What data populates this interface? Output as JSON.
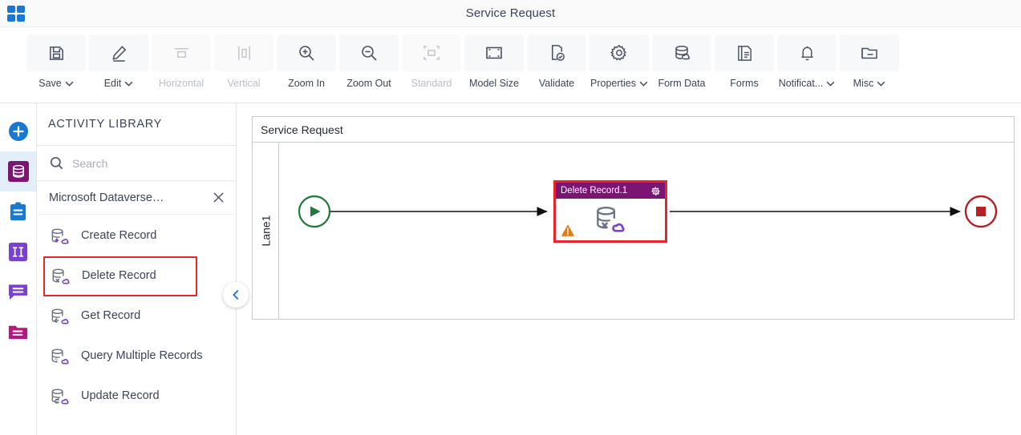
{
  "titlebar": {
    "app_icon": "app-grid-icon",
    "title": "Service Request"
  },
  "toolbar": {
    "items": [
      {
        "label": "Save",
        "icon": "save-icon",
        "has_caret": true,
        "disabled": false
      },
      {
        "label": "Edit",
        "icon": "edit-pencil-icon",
        "has_caret": true,
        "disabled": false
      },
      {
        "label": "Horizontal",
        "icon": "horizontal-align-icon",
        "has_caret": false,
        "disabled": true
      },
      {
        "label": "Vertical",
        "icon": "vertical-align-icon",
        "has_caret": false,
        "disabled": true
      },
      {
        "label": "Zoom In",
        "icon": "zoom-in-icon",
        "has_caret": false,
        "disabled": false
      },
      {
        "label": "Zoom Out",
        "icon": "zoom-out-icon",
        "has_caret": false,
        "disabled": false
      },
      {
        "label": "Standard",
        "icon": "standard-size-icon",
        "has_caret": false,
        "disabled": true
      },
      {
        "label": "Model Size",
        "icon": "model-size-icon",
        "has_caret": false,
        "disabled": false
      },
      {
        "label": "Validate",
        "icon": "validate-icon",
        "has_caret": false,
        "disabled": false
      },
      {
        "label": "Properties",
        "icon": "gear-icon",
        "has_caret": true,
        "disabled": false
      },
      {
        "label": "Form Data",
        "icon": "database-icon",
        "has_caret": false,
        "disabled": false
      },
      {
        "label": "Forms",
        "icon": "document-icon",
        "has_caret": false,
        "disabled": false
      },
      {
        "label": "Notificat...",
        "icon": "bell-icon",
        "has_caret": true,
        "disabled": false
      },
      {
        "label": "Misc",
        "icon": "folder-icon",
        "has_caret": true,
        "disabled": false
      }
    ]
  },
  "rail": {
    "items": [
      {
        "name": "add-button",
        "icon": "plus-circle-icon",
        "color": "#1878d2",
        "active": false
      },
      {
        "name": "activities",
        "icon": "database-icon",
        "color": "#7b1472",
        "active": true
      },
      {
        "name": "tasks",
        "icon": "clipboard-icon",
        "color": "#1878d2",
        "active": false
      },
      {
        "name": "forms",
        "icon": "form-columns-icon",
        "color": "#7a3fd4",
        "active": false
      },
      {
        "name": "messages",
        "icon": "chat-bubble-icon",
        "color": "#7a3fd4",
        "active": false
      },
      {
        "name": "files",
        "icon": "folder-icon",
        "color": "#b9157e",
        "active": false
      }
    ]
  },
  "panel": {
    "title": "ACTIVITY LIBRARY",
    "search": {
      "value": "",
      "placeholder": "Search",
      "icon": "search-icon"
    },
    "group": {
      "label": "Microsoft Dataverse…",
      "close_icon": "close-icon"
    },
    "activities": [
      {
        "label": "Create Record",
        "icon": "database-create-icon",
        "selected": false
      },
      {
        "label": "Delete Record",
        "icon": "database-delete-icon",
        "selected": true
      },
      {
        "label": "Get Record",
        "icon": "database-get-icon",
        "selected": false
      },
      {
        "label": "Query Multiple Records",
        "icon": "database-query-icon",
        "selected": false
      },
      {
        "label": "Update Record",
        "icon": "database-update-icon",
        "selected": false
      }
    ],
    "collapse_icon": "chevron-left-icon"
  },
  "canvas": {
    "pool_title": "Service Request",
    "lane_label": "Lane1",
    "start_node": {
      "icon": "start-play-icon",
      "color": "#1f7a3d"
    },
    "end_node": {
      "icon": "end-stop-icon",
      "color": "#b72025"
    },
    "activity_node": {
      "title": "Delete Record.1",
      "header_color": "#7b1472",
      "selection_color": "#e8262a",
      "gear_icon": "gear-icon",
      "body_icon": "database-delete-icon",
      "warning_icon": "warning-triangle-icon"
    }
  },
  "colors": {
    "accent_blue": "#1878d2",
    "purple": "#7b1472",
    "red": "#e8262a",
    "green": "#1f7a3d",
    "warning_orange": "#e8760c"
  }
}
